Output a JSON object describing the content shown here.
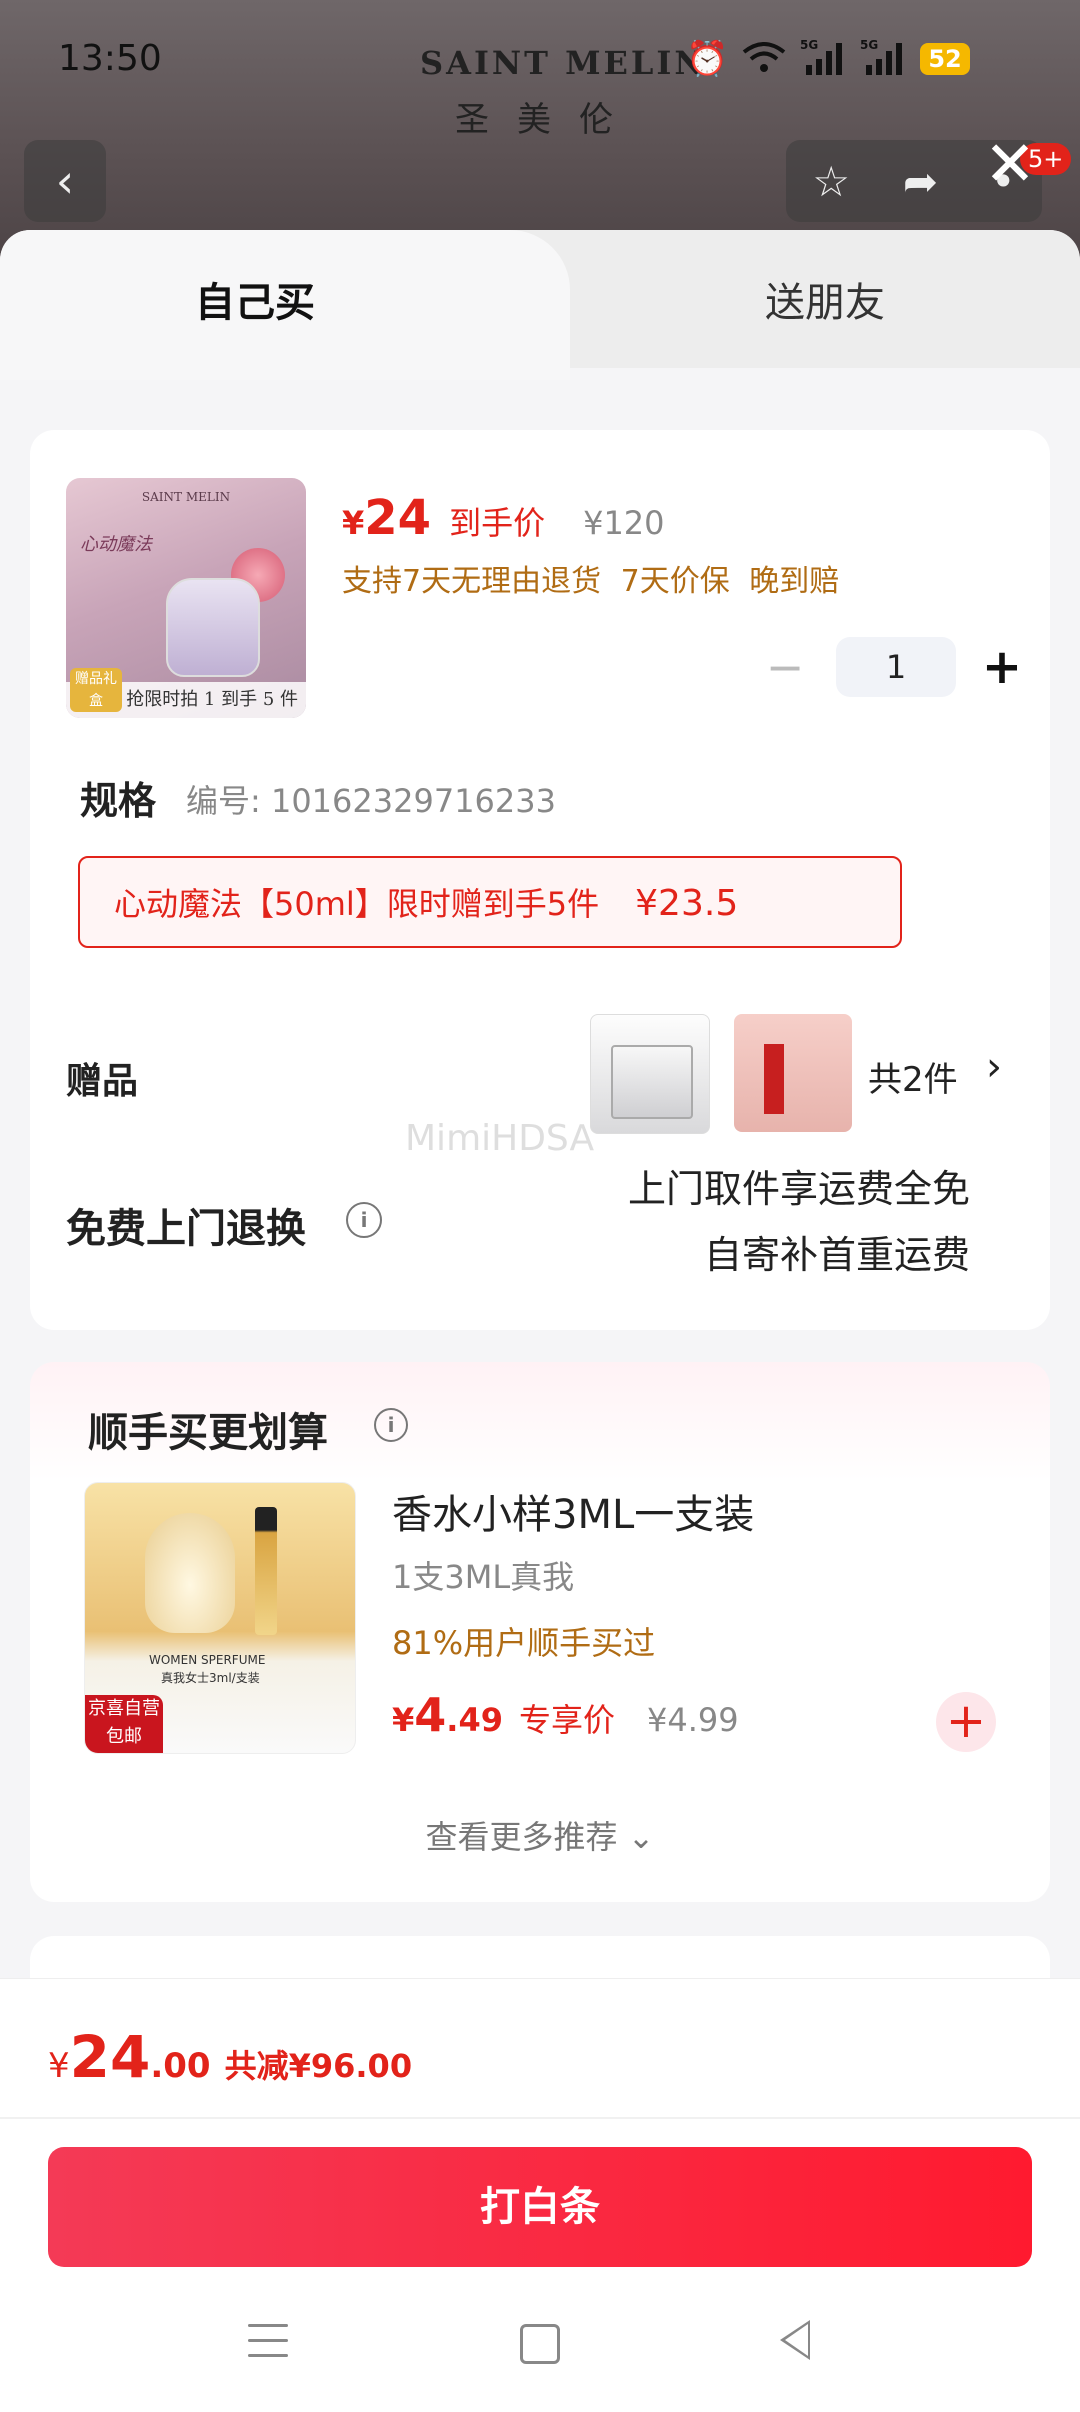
{
  "status_bar": {
    "time": "13:50",
    "battery": "52",
    "icons": [
      "alarm-icon",
      "wifi-icon",
      "5g-signal-icon",
      "5g-signal-icon",
      "battery-icon"
    ]
  },
  "background_page": {
    "brand_en": "SAINT MELIN",
    "brand_zh": "圣美伦",
    "badge": "5+"
  },
  "tabs": {
    "self": "自己买",
    "friend": "送朋友"
  },
  "product": {
    "image_brand": "SAINT MELIN",
    "image_title": "心动魔法",
    "image_bar": "抢限时拍 1 到手 5 件",
    "image_tag": "赠品礼盒",
    "price_symbol": "¥",
    "price": "24",
    "price_label": "到手价",
    "original_price": "¥120",
    "services": "支持7天无理由退货 7天价保 晚到赔",
    "quantity": "1",
    "minus": "−",
    "plus": "+"
  },
  "spec": {
    "title": "规格",
    "code": "编号: 10162329716233",
    "chip_label": "心动魔法【50ml】限时赠到手5件",
    "chip_price": "¥23.5"
  },
  "gift": {
    "label": "赠品",
    "count": "共2件",
    "chevron": "›"
  },
  "return_service": {
    "label": "免费上门退换",
    "info": "i",
    "line1": "上门取件享运费全免",
    "line2": "自寄补首重运费"
  },
  "watermark": "MimiHDSA",
  "recommend": {
    "title": "顺手买更划算",
    "info": "i",
    "item": {
      "image_text1": "WOMEN SPERFUME",
      "image_text2": "真我女士3ml/支装",
      "image_tag": "京喜自营 包邮",
      "name": "香水小样3ML一支装",
      "spec": "1支3ML真我",
      "social": "81%用户顺手买过",
      "price_symbol": "¥",
      "price_int": "4",
      "price_dec": ".49",
      "price_label": "专享价",
      "original_price": "¥4.99",
      "add": "+"
    },
    "more": "查看更多推荐 ⌄"
  },
  "footer": {
    "total_symbol": "¥",
    "total_int": "24",
    "total_dec": ".00",
    "savings": "共减¥96.00",
    "pay_button": "打白条"
  },
  "colors": {
    "accent_red": "#e2231a",
    "service_orange": "#b06c14",
    "pay_gradient_start": "#f43a56",
    "pay_gradient_end": "#ff1a2f"
  }
}
